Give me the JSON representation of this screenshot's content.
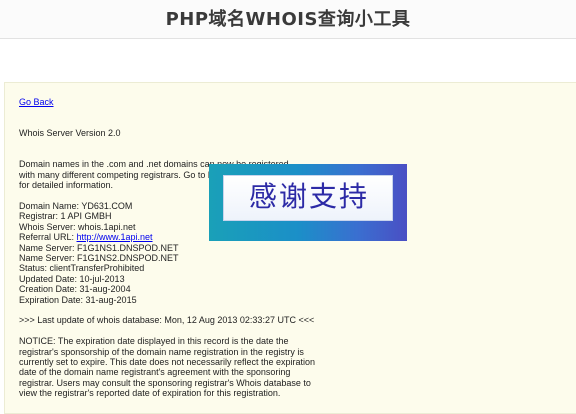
{
  "header": {
    "title": "PHP域名WHOIS查询小工具"
  },
  "nav": {
    "go_back": "Go Back"
  },
  "whois": {
    "version": "Whois Server Version 2.0",
    "intro_1": "Domain names in the .com and .net domains can now be registered",
    "intro_2": "with many different competing registrars. Go to http://www.internic.net",
    "intro_3": "for detailed information.",
    "domain_name": "Domain Name: YD631.COM",
    "registrar": "Registrar: 1 API GMBH",
    "whois_server": "Whois Server: whois.1api.net",
    "referral_label": "Referral URL: ",
    "referral_url": "http://www.1api.net",
    "name_server_1": "Name Server: F1G1NS1.DNSPOD.NET",
    "name_server_2": "Name Server: F1G1NS2.DNSPOD.NET",
    "status": "Status: clientTransferProhibited",
    "updated": "Updated Date: 10-jul-2013",
    "creation": "Creation Date: 31-aug-2004",
    "expiration": "Expiration Date: 31-aug-2015",
    "last_update": ">>> Last update of whois database: Mon, 12 Aug 2013 02:33:27 UTC <<<",
    "notice_1": "NOTICE: The expiration date displayed in this record is the date the",
    "notice_2": "registrar's sponsorship of the domain name registration in the registry is",
    "notice_3": "currently set to expire. This date does not necessarily reflect the expiration",
    "notice_4": "date of the domain name registrant's agreement with the sponsoring",
    "notice_5": "registrar. Users may consult the sponsoring registrar's Whois database to",
    "notice_6": "view the registrar's reported date of expiration for this registration."
  },
  "banner": {
    "text": "感谢支持"
  }
}
